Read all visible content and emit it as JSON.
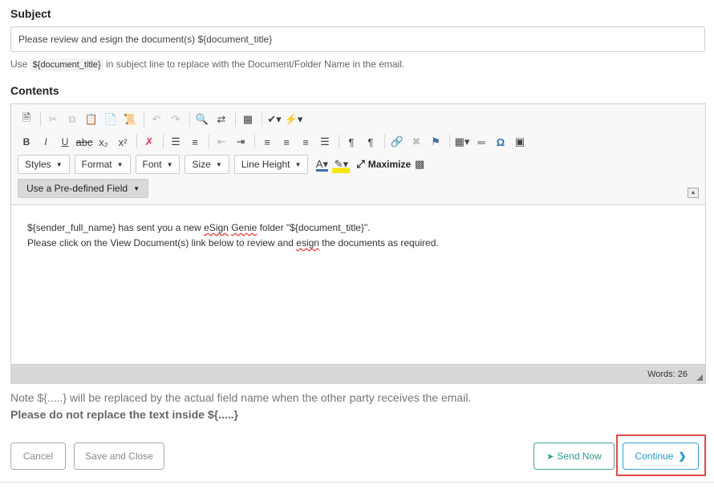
{
  "subject": {
    "label": "Subject",
    "value": "Please review and esign the document(s) ${document_title}",
    "hint_prefix": "Use",
    "hint_code": "${document_title}",
    "hint_suffix": "in subject line to replace with the Document/Folder Name in the email."
  },
  "contents": {
    "label": "Contents",
    "toolbar": {
      "styles": "Styles",
      "format": "Format",
      "font": "Font",
      "size": "Size",
      "line_height": "Line Height",
      "maximize": "Maximize",
      "predefined_field": "Use a Pre-defined Field"
    },
    "body": {
      "line1_a": "${sender_full_name} has sent you a new ",
      "line1_spell1": "eSign",
      "line1_b": " ",
      "line1_spell2": "Genie",
      "line1_c": " folder \"${document_title}\".",
      "line2_a": "Please click on the View Document(s) link below to review and ",
      "line2_spell": "esign",
      "line2_b": " the documents as required."
    },
    "word_count": "Words: 26"
  },
  "notes": {
    "note": "Note ${.....} will be replaced by the actual field name when the other party receives the email.",
    "warning": "Please do not replace the text inside ${.....}"
  },
  "buttons": {
    "cancel": "Cancel",
    "save_close": "Save and Close",
    "send_now": "Send Now",
    "continue": "Continue"
  }
}
